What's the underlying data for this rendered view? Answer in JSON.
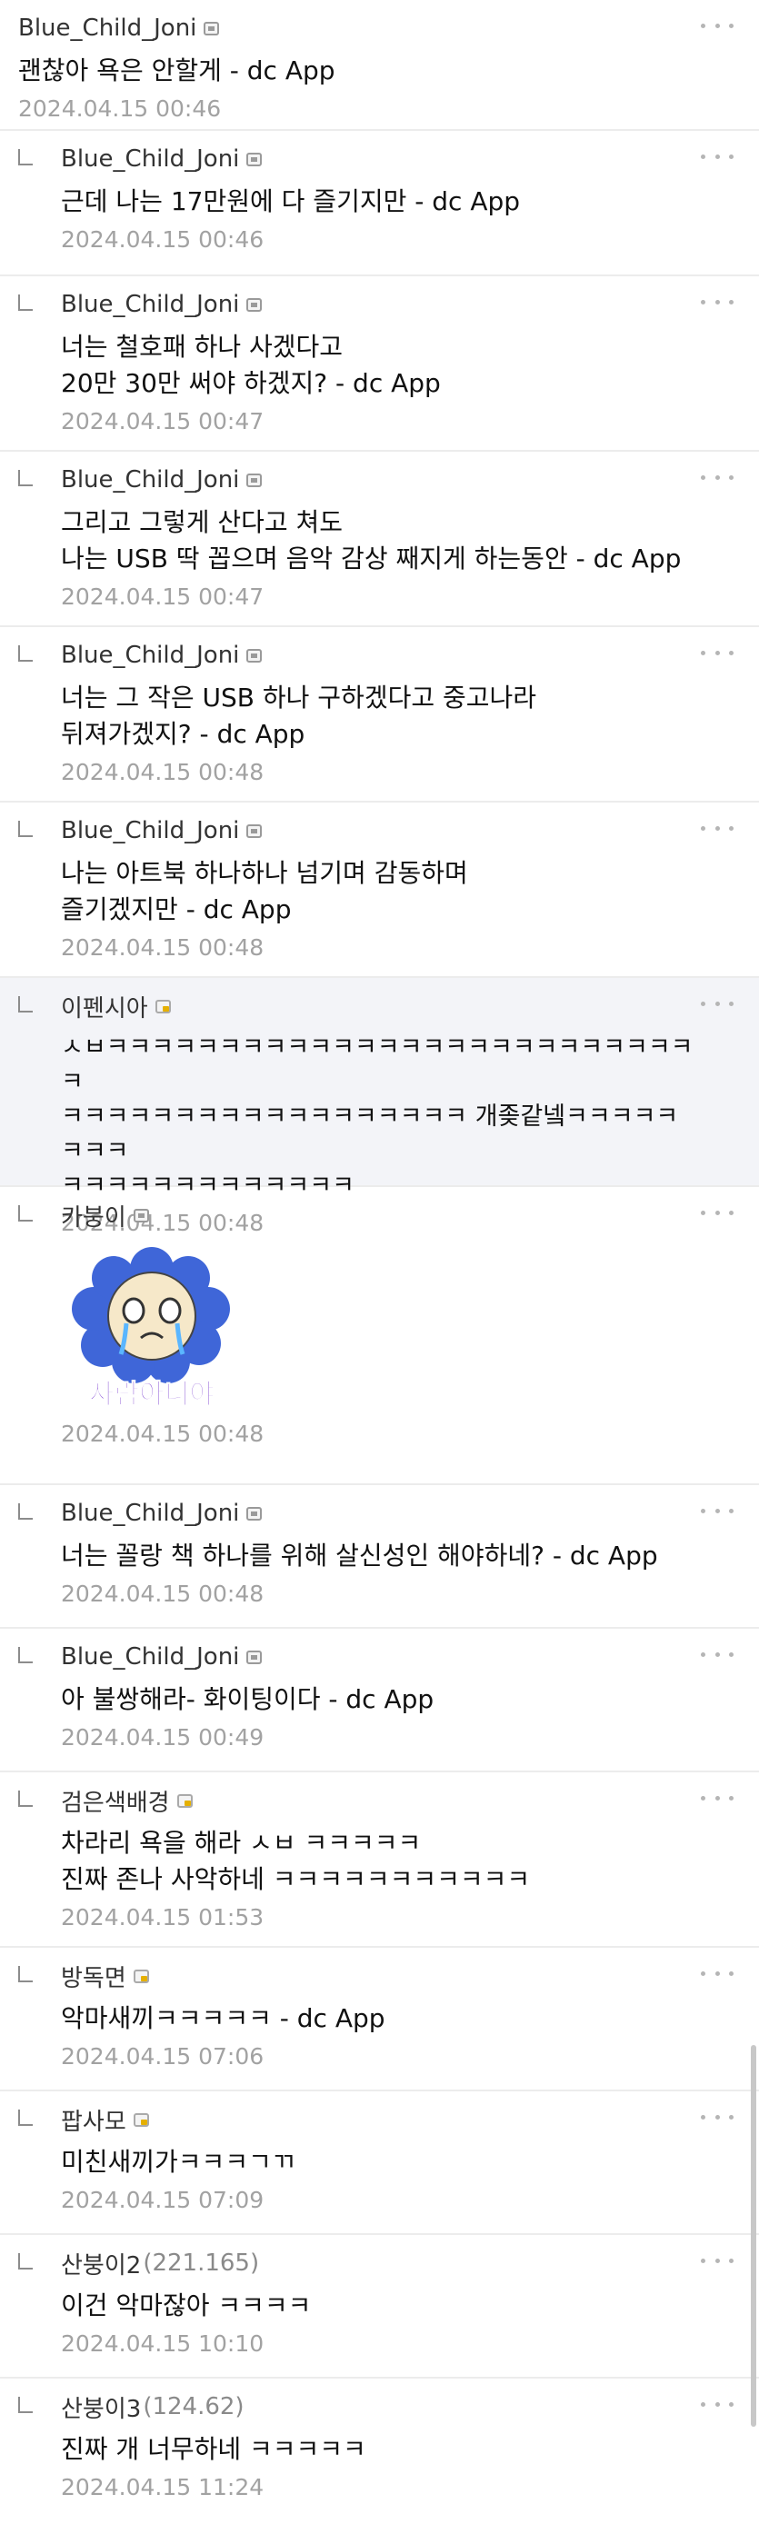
{
  "comments": [
    {
      "author": "Blue_Child_Joni",
      "ip": "",
      "badge": "plain",
      "reply": false,
      "text": "괜찮아 욕은 안할게 - dc App",
      "date": "2024.04.15 00:46"
    },
    {
      "author": "Blue_Child_Joni",
      "ip": "",
      "badge": "plain",
      "reply": true,
      "text": "근데 나는 17만원에 다 즐기지만 - dc App",
      "date": "2024.04.15 00:46"
    },
    {
      "author": "Blue_Child_Joni",
      "ip": "",
      "badge": "plain",
      "reply": true,
      "text": "너는 철호패 하나 사겠다고\n20만 30만 써야 하겠지? - dc App",
      "date": "2024.04.15 00:47"
    },
    {
      "author": "Blue_Child_Joni",
      "ip": "",
      "badge": "plain",
      "reply": true,
      "text": "그리고 그렇게 산다고 쳐도\n나는 USB 딱 꼽으며 음악 감상 째지게 하는동안 - dc App",
      "date": "2024.04.15 00:47"
    },
    {
      "author": "Blue_Child_Joni",
      "ip": "",
      "badge": "plain",
      "reply": true,
      "text": "너는 그 작은 USB 하나 구하겠다고 중고나라\n뒤져가겠지? - dc App",
      "date": "2024.04.15 00:48"
    },
    {
      "author": "Blue_Child_Joni",
      "ip": "",
      "badge": "plain",
      "reply": true,
      "text": "나는 아트북 하나하나 넘기며 감동하며\n즐기겠지만 - dc App",
      "date": "2024.04.15 00:48"
    },
    {
      "author": "이펜시아",
      "ip": "",
      "badge": "gold",
      "reply": true,
      "highlight": true,
      "text": "ㅅㅂㅋㅋㅋㅋㅋㅋㅋㅋㅋㅋㅋㅋㅋㅋㅋㅋㅋㅋㅋㅋㅋㅋㅋㅋㅋㅋㅋ\nㅋㅋㅋㅋㅋㅋㅋㅋㅋㅋㅋㅋㅋㅋㅋㅋㅋㅋ 개좆같넼ㅋㅋㅋㅋㅋㅋㅋㅋ\nㅋㅋㅋㅋㅋㅋㅋㅋㅋㅋㅋㅋㅋ",
      "date": "2024.04.15 00:48"
    },
    {
      "author": "카붕이",
      "ip": "",
      "badge": "plain",
      "reply": true,
      "sticker": true,
      "sticker_text": "사람아니야",
      "text": "",
      "date": "2024.04.15 00:48"
    },
    {
      "author": "Blue_Child_Joni",
      "ip": "",
      "badge": "plain",
      "reply": true,
      "text": "너는 꼴랑 책 하나를 위해 살신성인 해야하네? - dc App",
      "date": "2024.04.15 00:48"
    },
    {
      "author": "Blue_Child_Joni",
      "ip": "",
      "badge": "plain",
      "reply": true,
      "text": "아 불쌍해라- 화이팅이다 - dc App",
      "date": "2024.04.15 00:49"
    },
    {
      "author": "검은색배경",
      "ip": "",
      "badge": "gold",
      "reply": true,
      "text": "차라리 욕을 해라 ㅅㅂ ㅋㅋㅋㅋㅋ\n진짜 존나 사악하네 ㅋㅋㅋㅋㅋㅋㅋㅋㅋㅋㅋ",
      "date": "2024.04.15 01:53"
    },
    {
      "author": "방독면",
      "ip": "",
      "badge": "gold",
      "reply": true,
      "text": "악마새끼ㅋㅋㅋㅋㅋ - dc App",
      "date": "2024.04.15 07:06"
    },
    {
      "author": "팝사모",
      "ip": "",
      "badge": "gold",
      "reply": true,
      "text": "미친새끼가ㅋㅋㅋㄱㄲ",
      "date": "2024.04.15 07:09"
    },
    {
      "author": "산붕이2",
      "ip": "(221.165)",
      "badge": "none",
      "reply": true,
      "text": "이건 악마잖아 ㅋㅋㅋㅋ",
      "date": "2024.04.15 10:10"
    },
    {
      "author": "산붕이3",
      "ip": "(124.62)",
      "badge": "none",
      "reply": true,
      "text": "진짜 개 너무하네 ㅋㅋㅋㅋㅋ",
      "date": "2024.04.15 11:24"
    }
  ],
  "icons": {
    "more": "more-dots-icon",
    "reply": "reply-arrow-icon",
    "user": "user-badge-icon"
  },
  "colors": {
    "highlight_bg": "#f3f4f8",
    "date": "#a2a2a2",
    "sticker_flower": "#3f66d8",
    "sticker_text": "#7a3cd0"
  }
}
